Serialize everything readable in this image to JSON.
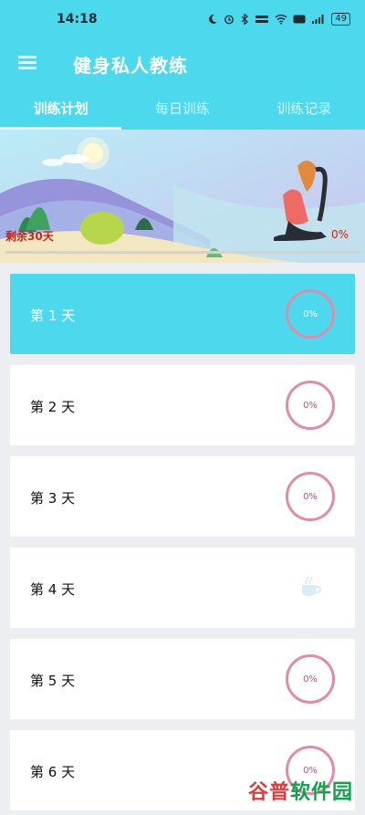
{
  "status": {
    "time": "14:18",
    "battery": "49"
  },
  "app": {
    "title": "健身私人教练"
  },
  "tabs": [
    {
      "label": "训练计划",
      "active": true
    },
    {
      "label": "每日训练",
      "active": false
    },
    {
      "label": "训练记录",
      "active": false
    }
  ],
  "banner": {
    "remaining": "剩余30天",
    "progress_text": "0%",
    "progress": 0
  },
  "days": [
    {
      "label": "第 1 天",
      "percent": "0%",
      "active": true,
      "rest": false
    },
    {
      "label": "第 2 天",
      "percent": "0%",
      "active": false,
      "rest": false
    },
    {
      "label": "第 3 天",
      "percent": "0%",
      "active": false,
      "rest": false
    },
    {
      "label": "第 4 天",
      "percent": "",
      "active": false,
      "rest": true
    },
    {
      "label": "第 5 天",
      "percent": "0%",
      "active": false,
      "rest": false
    },
    {
      "label": "第 6 天",
      "percent": "0%",
      "active": false,
      "rest": false
    }
  ],
  "watermark": {
    "part1": "谷普",
    "part2": "软件园"
  },
  "colors": {
    "accent": "#4cd9ee",
    "ring": "#e28aa8",
    "alert": "#c8241b"
  },
  "icons": {
    "menu": "menu-icon",
    "rest": "coffee-cup-icon"
  }
}
